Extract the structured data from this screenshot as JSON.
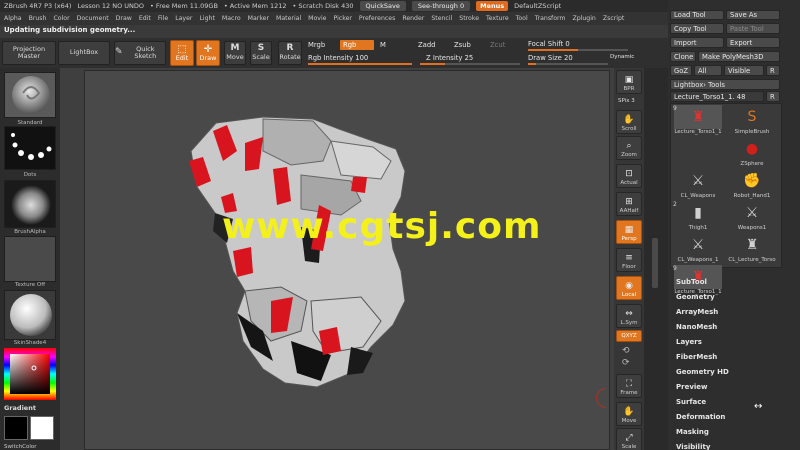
{
  "titlebar": {
    "app_title": "ZBrush 4R7 P3 (x64)",
    "doc": "Lesson 12 NO UNDO",
    "free_mem": "• Free Mem 11.09GB",
    "active_mem": "• Active Mem 1212",
    "scratch": "• Scratch Disk 430",
    "quicksave": "QuickSave",
    "see_through": "See-through  0",
    "menus": "Menus",
    "script": "DefaultZScript"
  },
  "menubar": [
    "Alpha",
    "Brush",
    "Color",
    "Document",
    "Draw",
    "Edit",
    "File",
    "Layer",
    "Light",
    "Macro",
    "Marker",
    "Material",
    "Movie",
    "Picker",
    "Preferences",
    "Render",
    "Stencil",
    "Stroke",
    "Texture",
    "Tool",
    "Transform",
    "Zplugin",
    "Zscript"
  ],
  "status": "Updating subdivision geometry...",
  "toolbar": {
    "projection_master": "Projection Master",
    "lightbox": "LightBox",
    "quick_sketch": "Quick Sketch",
    "edit": "Edit",
    "draw": "Draw",
    "move": "Move",
    "scale": "Scale",
    "rotate": "Rotate",
    "mrgb": "Mrgb",
    "rgb": "Rgb",
    "m": "M",
    "zadd": "Zadd",
    "zsub": "Zsub",
    "zcut": "Zcut",
    "rgb_intensity": "Rgb Intensity 100",
    "z_intensity": "Z Intensity 25",
    "focal_shift": "Focal Shift 0",
    "draw_size": "Draw Size 20",
    "dynamic": "Dynamic"
  },
  "sliders": {
    "rgb_intensity": 1.0,
    "z_intensity": 0.25,
    "focal_shift": 0.5,
    "draw_size": 0.1
  },
  "lefttray": {
    "standard": "Standard",
    "dots": "Dots",
    "brush_alpha": "BrushAlpha",
    "texture_off": "Texture Off",
    "skinshade": "SkinShade4",
    "gradient": "Gradient",
    "switch_color": "SwitchColor"
  },
  "rightshelf": {
    "bpr": "BPR",
    "spix": "SPix 3",
    "scroll": "Scroll",
    "zoom": "Zoom",
    "actual": "Actual",
    "aahalf": "AAHalf",
    "persp": "Persp",
    "floor": "Floor",
    "local": "Local",
    "lsym": "L.Sym",
    "xyz": "QXYZ",
    "frame": "Frame",
    "move": "Move",
    "scale": "Scale"
  },
  "toolpanel": {
    "load_tool": "Load Tool",
    "save_as": "Save As",
    "copy_tool": "Copy Tool",
    "paste_tool": "Paste Tool",
    "import": "Import",
    "export": "Export",
    "clone": "Clone",
    "make_polymesh": "Make PolyMesh3D",
    "goz": "GoZ",
    "all": "All",
    "visible": "Visible",
    "r": "R",
    "lightbox_tools": "Lightbox› Tools",
    "current_tool": "Lecture_Torso1_1. 48",
    "tools": [
      {
        "label": "Lecture_Torso1_1",
        "count": "9"
      },
      {
        "label": "SimpleBrush",
        "count": ""
      },
      {
        "label": "",
        "count": ""
      },
      {
        "label": "ZSphere",
        "count": ""
      },
      {
        "label": "CL_Weapons",
        "count": ""
      },
      {
        "label": "Robot_Hand1",
        "count": ""
      },
      {
        "label": "Thigh1",
        "count": "2"
      },
      {
        "label": "Weapons1",
        "count": ""
      },
      {
        "label": "CL_Weapons_1",
        "count": ""
      },
      {
        "label": "CL_Lecture_Torso",
        "count": ""
      },
      {
        "label": "Lecture_Torso1_1",
        "count": "9"
      }
    ],
    "menus": [
      "SubTool",
      "Geometry",
      "ArrayMesh",
      "NanoMesh",
      "Layers",
      "FiberMesh",
      "Geometry HD",
      "Preview",
      "Surface",
      "Deformation",
      "Masking",
      "Visibility"
    ]
  },
  "watermark": "www.cgtsj.com",
  "colors": {
    "accent": "#e0761f",
    "model_gray": "#c8c8c8",
    "model_red": "#d8141e",
    "watermark": "#f4f01a"
  }
}
